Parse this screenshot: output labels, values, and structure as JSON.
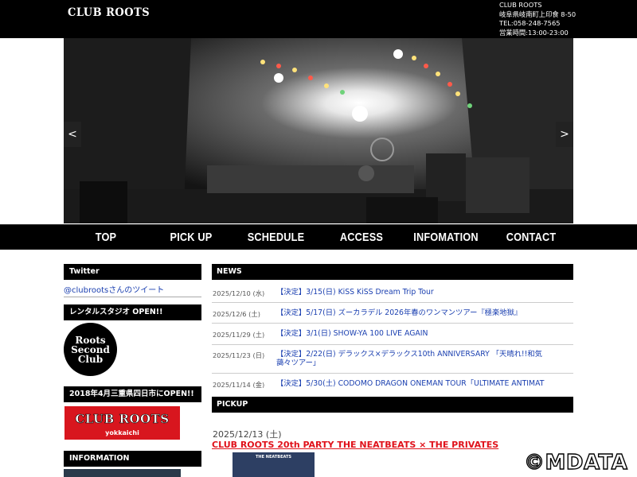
{
  "header": {
    "logo": "CLUB ROOTS",
    "info": [
      "CLUB ROOTS",
      "岐阜県岐南町上印食 8-50",
      "TEL:058-248-7565",
      "営業時間:13:00-23:00"
    ]
  },
  "slider": {
    "prev": "<",
    "next": ">"
  },
  "nav": {
    "items": [
      "TOP",
      "PICK UP",
      "SCHEDULE",
      "ACCESS",
      "INFOMATION",
      "CONTACT"
    ]
  },
  "sidebar": {
    "twitter_head": "Twitter",
    "twitter_link": "@clubrootsさんのツイート",
    "rental_head": "レンタルスタジオ OPEN!!",
    "rental_badge": [
      "Roots",
      "Second",
      "Club"
    ],
    "yokkaichi_head": "2018年4月三重県四日市にOPEN!!",
    "yokkaichi_banner": "CLUB ROOTS",
    "yokkaichi_sub": "yokkaichi",
    "info_head": "INFORMATION"
  },
  "news": {
    "head": "NEWS",
    "items": [
      {
        "date": "2025/12/10 (水)",
        "title": "【決定】3/15(日) KiSS KiSS Dream Trip Tour"
      },
      {
        "date": "2025/12/6 (土)",
        "title": "【決定】5/17(日) ズーカラデル 2026年春のワンマンツアー『極楽地獄』"
      },
      {
        "date": "2025/11/29 (土)",
        "title": "【決定】3/1(日) SHOW-YA 100 LIVE AGAIN"
      },
      {
        "date": "2025/11/23 (日)",
        "title": "【決定】2/22(日) デラックス×デラックス10th ANNIVERSARY 「天晴れ!!和気藹々ツアー」"
      },
      {
        "date": "2025/11/14 (金)",
        "title": "【決定】5/30(土) CODOMO DRAGON ONEMAN TOUR「ULTIMATE ANTIMAT"
      }
    ]
  },
  "pickup": {
    "head": "PICKUP",
    "date": "2025/12/13 (土)",
    "title": "CLUB ROOTS 20th PARTY THE NEATBEATS × THE PRIVATES",
    "image_caption": "THE NEATBEATS"
  },
  "watermark": "©MDATA",
  "colors": {
    "black": "#000000",
    "link": "#1a3fb0",
    "accent_red": "#e0121b",
    "banner_red": "#d8161e"
  }
}
